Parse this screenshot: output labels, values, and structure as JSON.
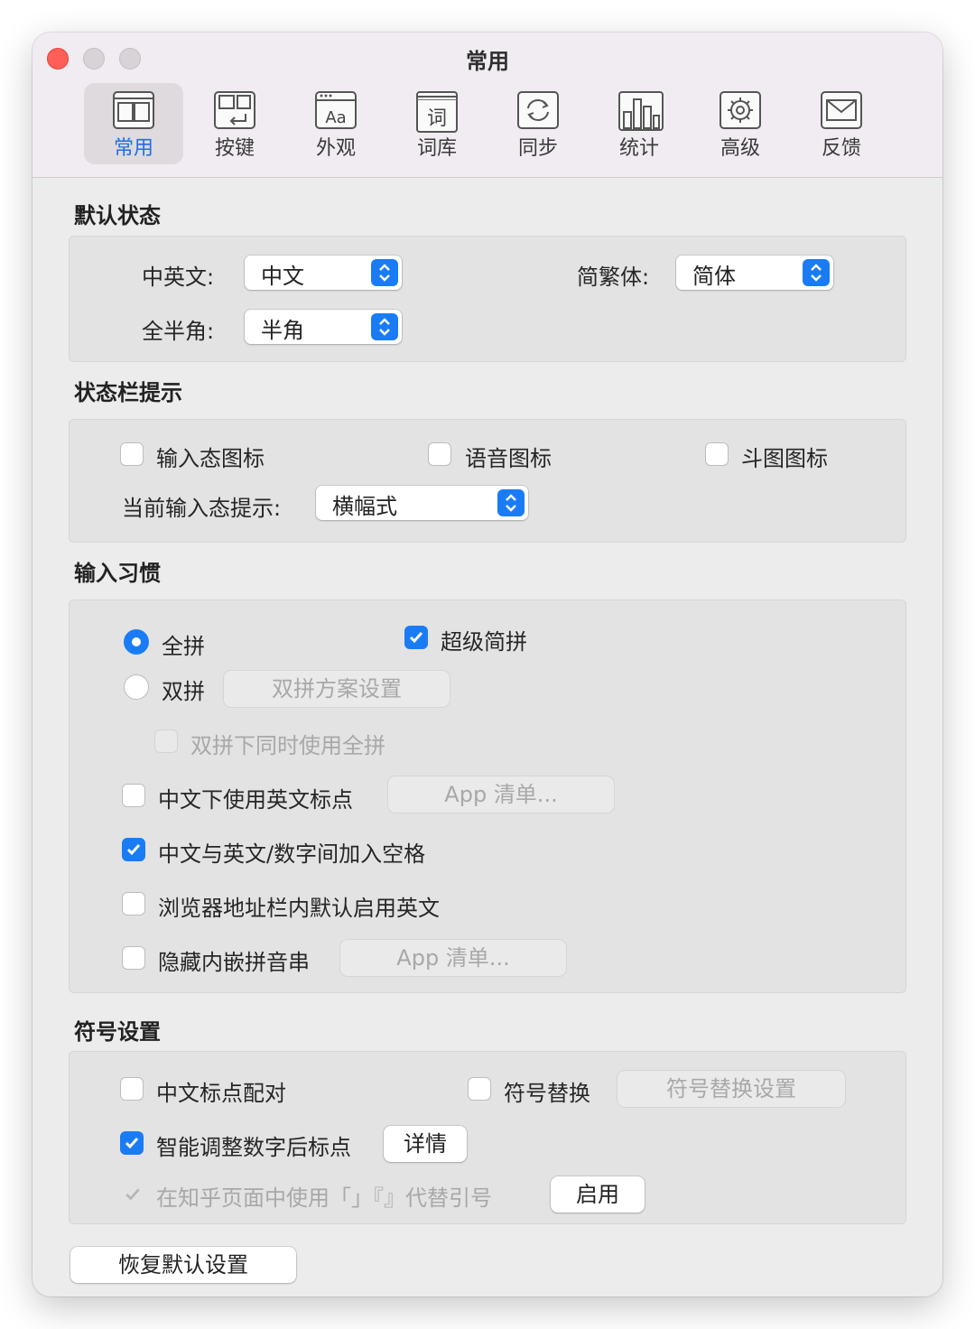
{
  "window": {
    "title": "常用"
  },
  "toolbar": {
    "items": [
      {
        "label": "常用",
        "icon": "general-icon",
        "active": true
      },
      {
        "label": "按键",
        "icon": "keys-icon"
      },
      {
        "label": "外观",
        "icon": "appearance-icon"
      },
      {
        "label": "词库",
        "icon": "dictionary-icon"
      },
      {
        "label": "同步",
        "icon": "sync-icon"
      },
      {
        "label": "统计",
        "icon": "statistics-icon"
      },
      {
        "label": "高级",
        "icon": "advanced-gear-icon"
      },
      {
        "label": "反馈",
        "icon": "feedback-mail-icon"
      }
    ]
  },
  "default_state": {
    "title": "默认状态",
    "cn_en_label": "中英文:",
    "cn_en_value": "中文",
    "simp_trad_label": "简繁体:",
    "simp_trad_value": "简体",
    "width_label": "全半角:",
    "width_value": "半角"
  },
  "status_bar": {
    "title": "状态栏提示",
    "input_icon_label": "输入态图标",
    "input_icon_checked": false,
    "voice_icon_label": "语音图标",
    "voice_icon_checked": false,
    "meme_icon_label": "斗图图标",
    "meme_icon_checked": false,
    "hint_label": "当前输入态提示:",
    "hint_value": "横幅式"
  },
  "input_habits": {
    "title": "输入习惯",
    "full_pinyin_label": "全拼",
    "full_pinyin_selected": true,
    "super_abbrev_label": "超级简拼",
    "super_abbrev_checked": true,
    "double_pinyin_label": "双拼",
    "double_pinyin_selected": false,
    "double_scheme_button": "双拼方案设置",
    "double_with_full_label": "双拼下同时使用全拼",
    "en_punct_label": "中文下使用英文标点",
    "en_punct_checked": false,
    "app_list_button_1": "App 清单...",
    "space_label": "中文与英文/数字间加入空格",
    "space_checked": true,
    "browser_label": "浏览器地址栏内默认启用英文",
    "browser_checked": false,
    "hide_embedded_label": "隐藏内嵌拼音串",
    "hide_embedded_checked": false,
    "app_list_button_2": "App 清单..."
  },
  "symbols": {
    "title": "符号设置",
    "pair_label": "中文标点配对",
    "pair_checked": false,
    "replace_label": "符号替换",
    "replace_checked": false,
    "replace_settings_button": "符号替换设置",
    "smart_label": "智能调整数字后标点",
    "smart_checked": true,
    "details_button": "详情",
    "zhihu_label": "在知乎页面中使用「」『』代替引号",
    "zhihu_checked": true,
    "enable_button": "启用"
  },
  "restore_button": "恢复默认设置",
  "colors": {
    "accent": "#1a7cf5",
    "close": "#ff5f57",
    "active_tab": "#1f6fe0"
  }
}
